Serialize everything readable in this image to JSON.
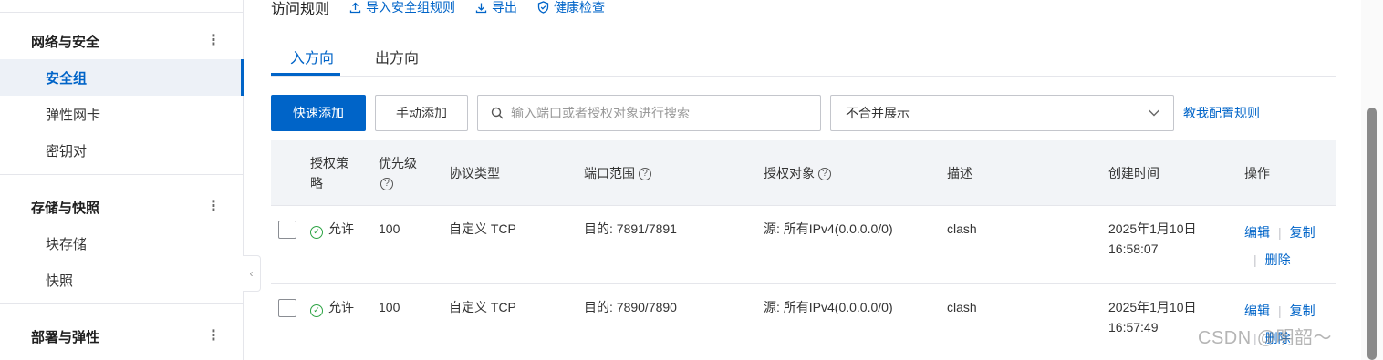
{
  "sidebar": {
    "groups": [
      {
        "title": "网络与安全",
        "items": [
          {
            "label": "安全组",
            "active": true
          },
          {
            "label": "弹性网卡"
          },
          {
            "label": "密钥对"
          }
        ]
      },
      {
        "title": "存储与快照",
        "items": [
          {
            "label": "块存储"
          },
          {
            "label": "快照"
          }
        ]
      },
      {
        "title": "部署与弹性",
        "items": []
      }
    ],
    "more_glyph": "⋮",
    "collapse_glyph": "‹"
  },
  "header": {
    "title": "访问规则",
    "actions": [
      {
        "label": "导入安全组规则",
        "icon": "upload-icon"
      },
      {
        "label": "导出",
        "icon": "download-icon"
      },
      {
        "label": "健康检查",
        "icon": "shield-check-icon"
      }
    ]
  },
  "tabs": [
    {
      "label": "入方向",
      "active": true
    },
    {
      "label": "出方向",
      "active": false
    }
  ],
  "toolbar": {
    "quick_add": "快速添加",
    "manual_add": "手动添加",
    "search_placeholder": "输入端口或者授权对象进行搜索",
    "display_mode": "不合并展示",
    "help_link": "教我配置规则"
  },
  "table": {
    "columns": {
      "policy_line1": "授权策",
      "policy_line2": "略",
      "priority": "优先级",
      "protocol": "协议类型",
      "port_range": "端口范围",
      "auth_object": "授权对象",
      "description": "描述",
      "created": "创建时间",
      "actions": "操作"
    },
    "rows": [
      {
        "policy": "允许",
        "priority": "100",
        "protocol": "自定义 TCP",
        "port": "目的: 7891/7891",
        "object": "源: 所有IPv4(0.0.0.0/0)",
        "desc": "clash",
        "date": "2025年1月10日",
        "time": "16:58:07",
        "edit": "编辑",
        "copy": "复制",
        "delete": "删除"
      },
      {
        "policy": "允许",
        "priority": "100",
        "protocol": "自定义 TCP",
        "port": "目的: 7890/7890",
        "object": "源: 所有IPv4(0.0.0.0/0)",
        "desc": "clash",
        "date": "2025年1月10日",
        "time": "16:57:49",
        "edit": "编辑",
        "copy": "复制",
        "delete": "删除"
      }
    ]
  },
  "watermark": "CSDN @明韶～",
  "colors": {
    "accent": "#0064c8",
    "success": "#2ca343",
    "header_bg": "#f2f4f7"
  }
}
